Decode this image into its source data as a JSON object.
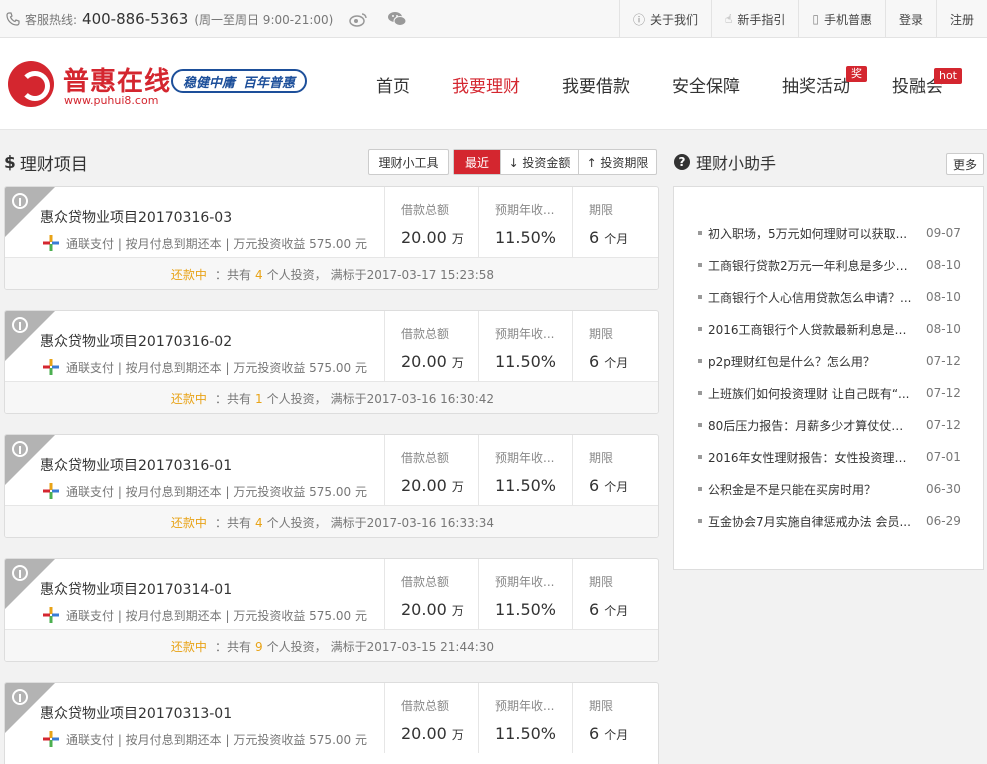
{
  "topbar": {
    "hotline_label": "客服热线:",
    "hotline_number": "400-886-5363",
    "hotline_hours": "(周一至周日 9:00-21:00)",
    "links": [
      {
        "label": "关于我们",
        "icon": "info-icon",
        "glyph": "ⓘ"
      },
      {
        "label": "新手指引",
        "icon": "pointer-icon",
        "glyph": "☝"
      },
      {
        "label": "手机普惠",
        "icon": "mobile-icon",
        "glyph": "▯"
      },
      {
        "label": "登录"
      },
      {
        "label": "注册"
      }
    ]
  },
  "header": {
    "brand": "普惠在线",
    "url": "www.puhui8.com",
    "slogan_a": "稳健中庸",
    "slogan_b": "百年普惠",
    "nav": [
      {
        "label": "首页"
      },
      {
        "label": "我要理财",
        "active": true
      },
      {
        "label": "我要借款"
      },
      {
        "label": "安全保障"
      },
      {
        "label": "抽奖活动",
        "badge": "奖"
      },
      {
        "label": "投融会",
        "badge": "hot"
      }
    ]
  },
  "section": {
    "title": "理财项目",
    "tool_label": "理财小工具",
    "sorts": [
      "最近",
      "↓ 投资金额",
      "↑ 投资期限"
    ]
  },
  "projects": [
    {
      "title": "惠众贷物业项目20170316-03",
      "sub": "通联支付 | 按月付息到期还本 | 万元投资收益 575.00 元",
      "amount": "20.00",
      "amount_unit": "万",
      "rate": "11.50%",
      "term": "6",
      "term_unit": "个月",
      "status": "还款中",
      "investors": "4",
      "finish": "满标于2017-03-17 15:23:58"
    },
    {
      "title": "惠众贷物业项目20170316-02",
      "sub": "通联支付 | 按月付息到期还本 | 万元投资收益 575.00 元",
      "amount": "20.00",
      "amount_unit": "万",
      "rate": "11.50%",
      "term": "6",
      "term_unit": "个月",
      "status": "还款中",
      "investors": "1",
      "finish": "满标于2017-03-16 16:30:42"
    },
    {
      "title": "惠众贷物业项目20170316-01",
      "sub": "通联支付 | 按月付息到期还本 | 万元投资收益 575.00 元",
      "amount": "20.00",
      "amount_unit": "万",
      "rate": "11.50%",
      "term": "6",
      "term_unit": "个月",
      "status": "还款中",
      "investors": "4",
      "finish": "满标于2017-03-16 16:33:34"
    },
    {
      "title": "惠众贷物业项目20170314-01",
      "sub": "通联支付 | 按月付息到期还本 | 万元投资收益 575.00 元",
      "amount": "20.00",
      "amount_unit": "万",
      "rate": "11.50%",
      "term": "6",
      "term_unit": "个月",
      "status": "还款中",
      "investors": "9",
      "finish": "满标于2017-03-15 21:44:30"
    },
    {
      "title": "惠众贷物业项目20170313-01",
      "sub": "通联支付 | 按月付息到期还本 | 万元投资收益 575.00 元",
      "amount": "20.00",
      "amount_unit": "万",
      "rate": "11.50%",
      "term": "6",
      "term_unit": "个月"
    }
  ],
  "labels": {
    "amount": "借款总额",
    "rate": "预期年收...",
    "term": "期限",
    "total_prefix": "：共有",
    "total_suffix": "个人投资，"
  },
  "helper": {
    "title": "理财小助手",
    "more": "更多",
    "items": [
      {
        "title": "初入职场，5万元如何理财可以获取...",
        "date": "09-07"
      },
      {
        "title": "工商银行贷款2万元一年利息是多少?...",
        "date": "08-10"
      },
      {
        "title": "工商银行个人心信用贷款怎么申请？...",
        "date": "08-10"
      },
      {
        "title": "2016工商银行个人贷款最新利息是多...",
        "date": "08-10"
      },
      {
        "title": "p2p理财红包是什么？怎么用？",
        "date": "07-12"
      },
      {
        "title": "上班族们如何投资理财 让自己既有“...",
        "date": "07-12"
      },
      {
        "title": "80后压力报告：月薪多少才算仗仗者...",
        "date": "07-12"
      },
      {
        "title": "2016年女性理财报告：女性投资理财...",
        "date": "07-01"
      },
      {
        "title": "公积金是不是只能在买房时用？",
        "date": "06-30"
      },
      {
        "title": "互金协会7月实施自律惩戒办法 会员...",
        "date": "06-29"
      }
    ]
  },
  "colors": {
    "brand_red": "#d4262f",
    "status_orange": "#e8a317",
    "slogan_blue": "#1d4f9a"
  }
}
